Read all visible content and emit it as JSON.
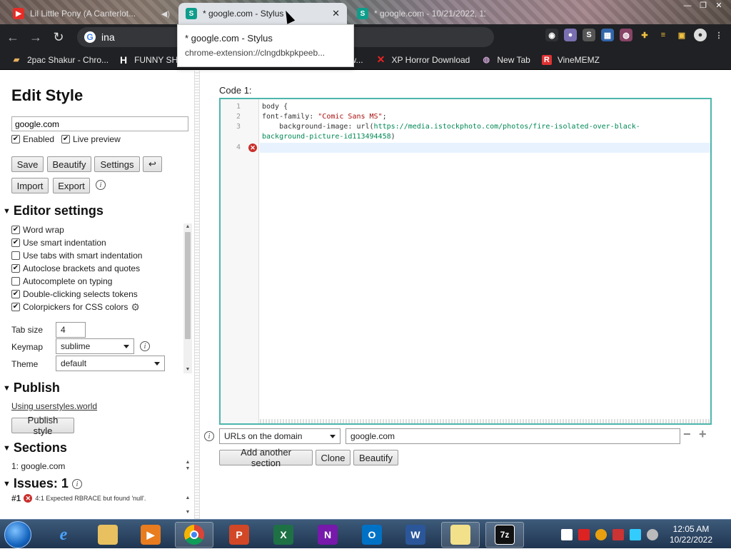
{
  "browser": {
    "tabs": [
      {
        "title": "Lil Little Pony  (A Canterlot...",
        "icon": "youtube-icon"
      },
      {
        "title": "* google.com - Stylus",
        "icon": "stylus-icon"
      },
      {
        "title": "* google.com - 10/21/2022, 11...",
        "icon": "stylus-icon"
      }
    ],
    "omnibox_text": "ina",
    "tooltip": {
      "title": "* google.com - Stylus",
      "url": "chrome-extension://clngdbkpkpeeb..."
    },
    "bookmarks": [
      {
        "label": "2pac Shakur - Chro...",
        "icon": "folder-icon"
      },
      {
        "label": "FUNNY SH",
        "icon": "h-icon"
      },
      {
        "label": "H/Malw...",
        "icon": "link-icon"
      },
      {
        "label": "XP Horror Download",
        "icon": "x-icon"
      },
      {
        "label": "New Tab",
        "icon": "globe-icon"
      },
      {
        "label": "VineMEMZ",
        "icon": "r-icon"
      }
    ],
    "colors": {
      "accent": "#4db6ac",
      "error": "#c9302c",
      "toolbar": "#202124"
    }
  },
  "left_panel": {
    "title": "Edit Style",
    "style_name": "google.com",
    "enabled_label": "Enabled",
    "live_preview_label": "Live preview",
    "buttons": {
      "save": "Save",
      "beautify": "Beautify",
      "settings": "Settings",
      "undo": "↩",
      "import": "Import",
      "export": "Export"
    },
    "editor_settings": {
      "heading": "Editor settings",
      "options": [
        {
          "label": "Word wrap",
          "checked": true
        },
        {
          "label": "Use smart indentation",
          "checked": true
        },
        {
          "label": "Use tabs with smart indentation",
          "checked": false
        },
        {
          "label": "Autoclose brackets and quotes",
          "checked": true
        },
        {
          "label": "Autocomplete on typing",
          "checked": false
        },
        {
          "label": "Double-clicking selects tokens",
          "checked": true
        },
        {
          "label": "Colorpickers for CSS colors",
          "checked": true
        }
      ],
      "tab_size_label": "Tab size",
      "tab_size_value": "4",
      "keymap_label": "Keymap",
      "keymap_value": "sublime",
      "theme_label": "Theme",
      "theme_value": "default"
    },
    "publish": {
      "heading": "Publish",
      "link": "Using userstyles.world",
      "button": "Publish style"
    },
    "sections": {
      "heading": "Sections",
      "item": "1: google.com"
    },
    "issues": {
      "heading": "Issues: 1",
      "num": "#1",
      "message": "4:1  Expected RBRACE but found 'null'."
    }
  },
  "editor": {
    "label": "Code 1:",
    "lines": [
      {
        "n": "1",
        "text": "body {"
      },
      {
        "n": "2",
        "prop": "font-family: ",
        "value": "\"Comic Sans MS\"",
        "end": ";"
      },
      {
        "n": "3",
        "prop": "    background-image: url(",
        "url": "https://media.istockphoto.com/photos/fire-isolated-over-black-",
        "url2": "background-picture-id113494458",
        "end": ")"
      },
      {
        "n": "4",
        "text": ""
      }
    ],
    "applies_select": "URLs on the domain",
    "applies_value": "google.com",
    "add_section": "Add another section",
    "clone": "Clone",
    "beautify": "Beautify"
  },
  "taskbar": {
    "clock_time": "12:05 AM",
    "clock_date": "10/22/2022",
    "apps": [
      "internet-explorer-icon",
      "explorer-icon",
      "media-player-icon",
      "chrome-icon",
      "powerpoint-icon",
      "excel-icon",
      "onenote-icon",
      "outlook-icon",
      "word-icon",
      "folder-icon",
      "7zip-icon"
    ]
  }
}
